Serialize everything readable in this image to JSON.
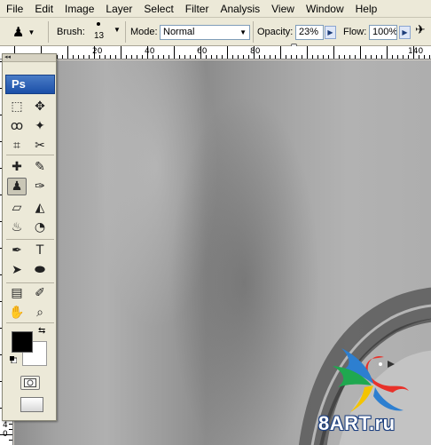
{
  "menu": [
    "File",
    "Edit",
    "Image",
    "Layer",
    "Select",
    "Filter",
    "Analysis",
    "View",
    "Window",
    "Help"
  ],
  "options": {
    "brush_label": "Brush:",
    "brush_size": "13",
    "mode_label": "Mode:",
    "mode_value": "Normal",
    "opacity_label": "Opacity:",
    "opacity_value": "23%",
    "flow_label": "Flow:",
    "flow_value": "100%",
    "opacity_slider_fraction": 0.23
  },
  "ruler_top_labels": [
    "20",
    "40",
    "60",
    "80",
    "140"
  ],
  "ruler_left_labels": [
    "4",
    "0"
  ],
  "toolbox": {
    "header": "Ps",
    "collapse_glyph": "◂◂",
    "tools": [
      {
        "name": "marquee-tool-icon",
        "glyph": "⬚"
      },
      {
        "name": "move-tool-icon",
        "glyph": "✥"
      },
      {
        "name": "lasso-tool-icon",
        "glyph": "ꝏ"
      },
      {
        "name": "magic-wand-tool-icon",
        "glyph": "✦"
      },
      {
        "name": "crop-tool-icon",
        "glyph": "⌗"
      },
      {
        "name": "slice-tool-icon",
        "glyph": "✂"
      },
      {
        "name": "healing-brush-tool-icon",
        "glyph": "✚"
      },
      {
        "name": "brush-tool-icon",
        "glyph": "✎"
      },
      {
        "name": "clone-stamp-tool-icon",
        "glyph": "♟"
      },
      {
        "name": "history-brush-tool-icon",
        "glyph": "✑"
      },
      {
        "name": "eraser-tool-icon",
        "glyph": "▱"
      },
      {
        "name": "paint-bucket-tool-icon",
        "glyph": "◭"
      },
      {
        "name": "blur-tool-icon",
        "glyph": "♨"
      },
      {
        "name": "dodge-tool-icon",
        "glyph": "◔"
      },
      {
        "name": "pen-tool-icon",
        "glyph": "✒"
      },
      {
        "name": "type-tool-icon",
        "glyph": "T"
      },
      {
        "name": "path-selection-tool-icon",
        "glyph": "➤"
      },
      {
        "name": "shape-tool-icon",
        "glyph": "⬬"
      },
      {
        "name": "notes-tool-icon",
        "glyph": "▤"
      },
      {
        "name": "eyedropper-tool-icon",
        "glyph": "✐"
      },
      {
        "name": "hand-tool-icon",
        "glyph": "✋"
      },
      {
        "name": "zoom-tool-icon",
        "glyph": "⌕"
      }
    ]
  },
  "colors": {
    "foreground": "#000000",
    "background": "#ffffff",
    "ps_blue": "#1b4fa8"
  },
  "watermark": {
    "text": "8ART.ru",
    "logo": "parrot-logo"
  }
}
